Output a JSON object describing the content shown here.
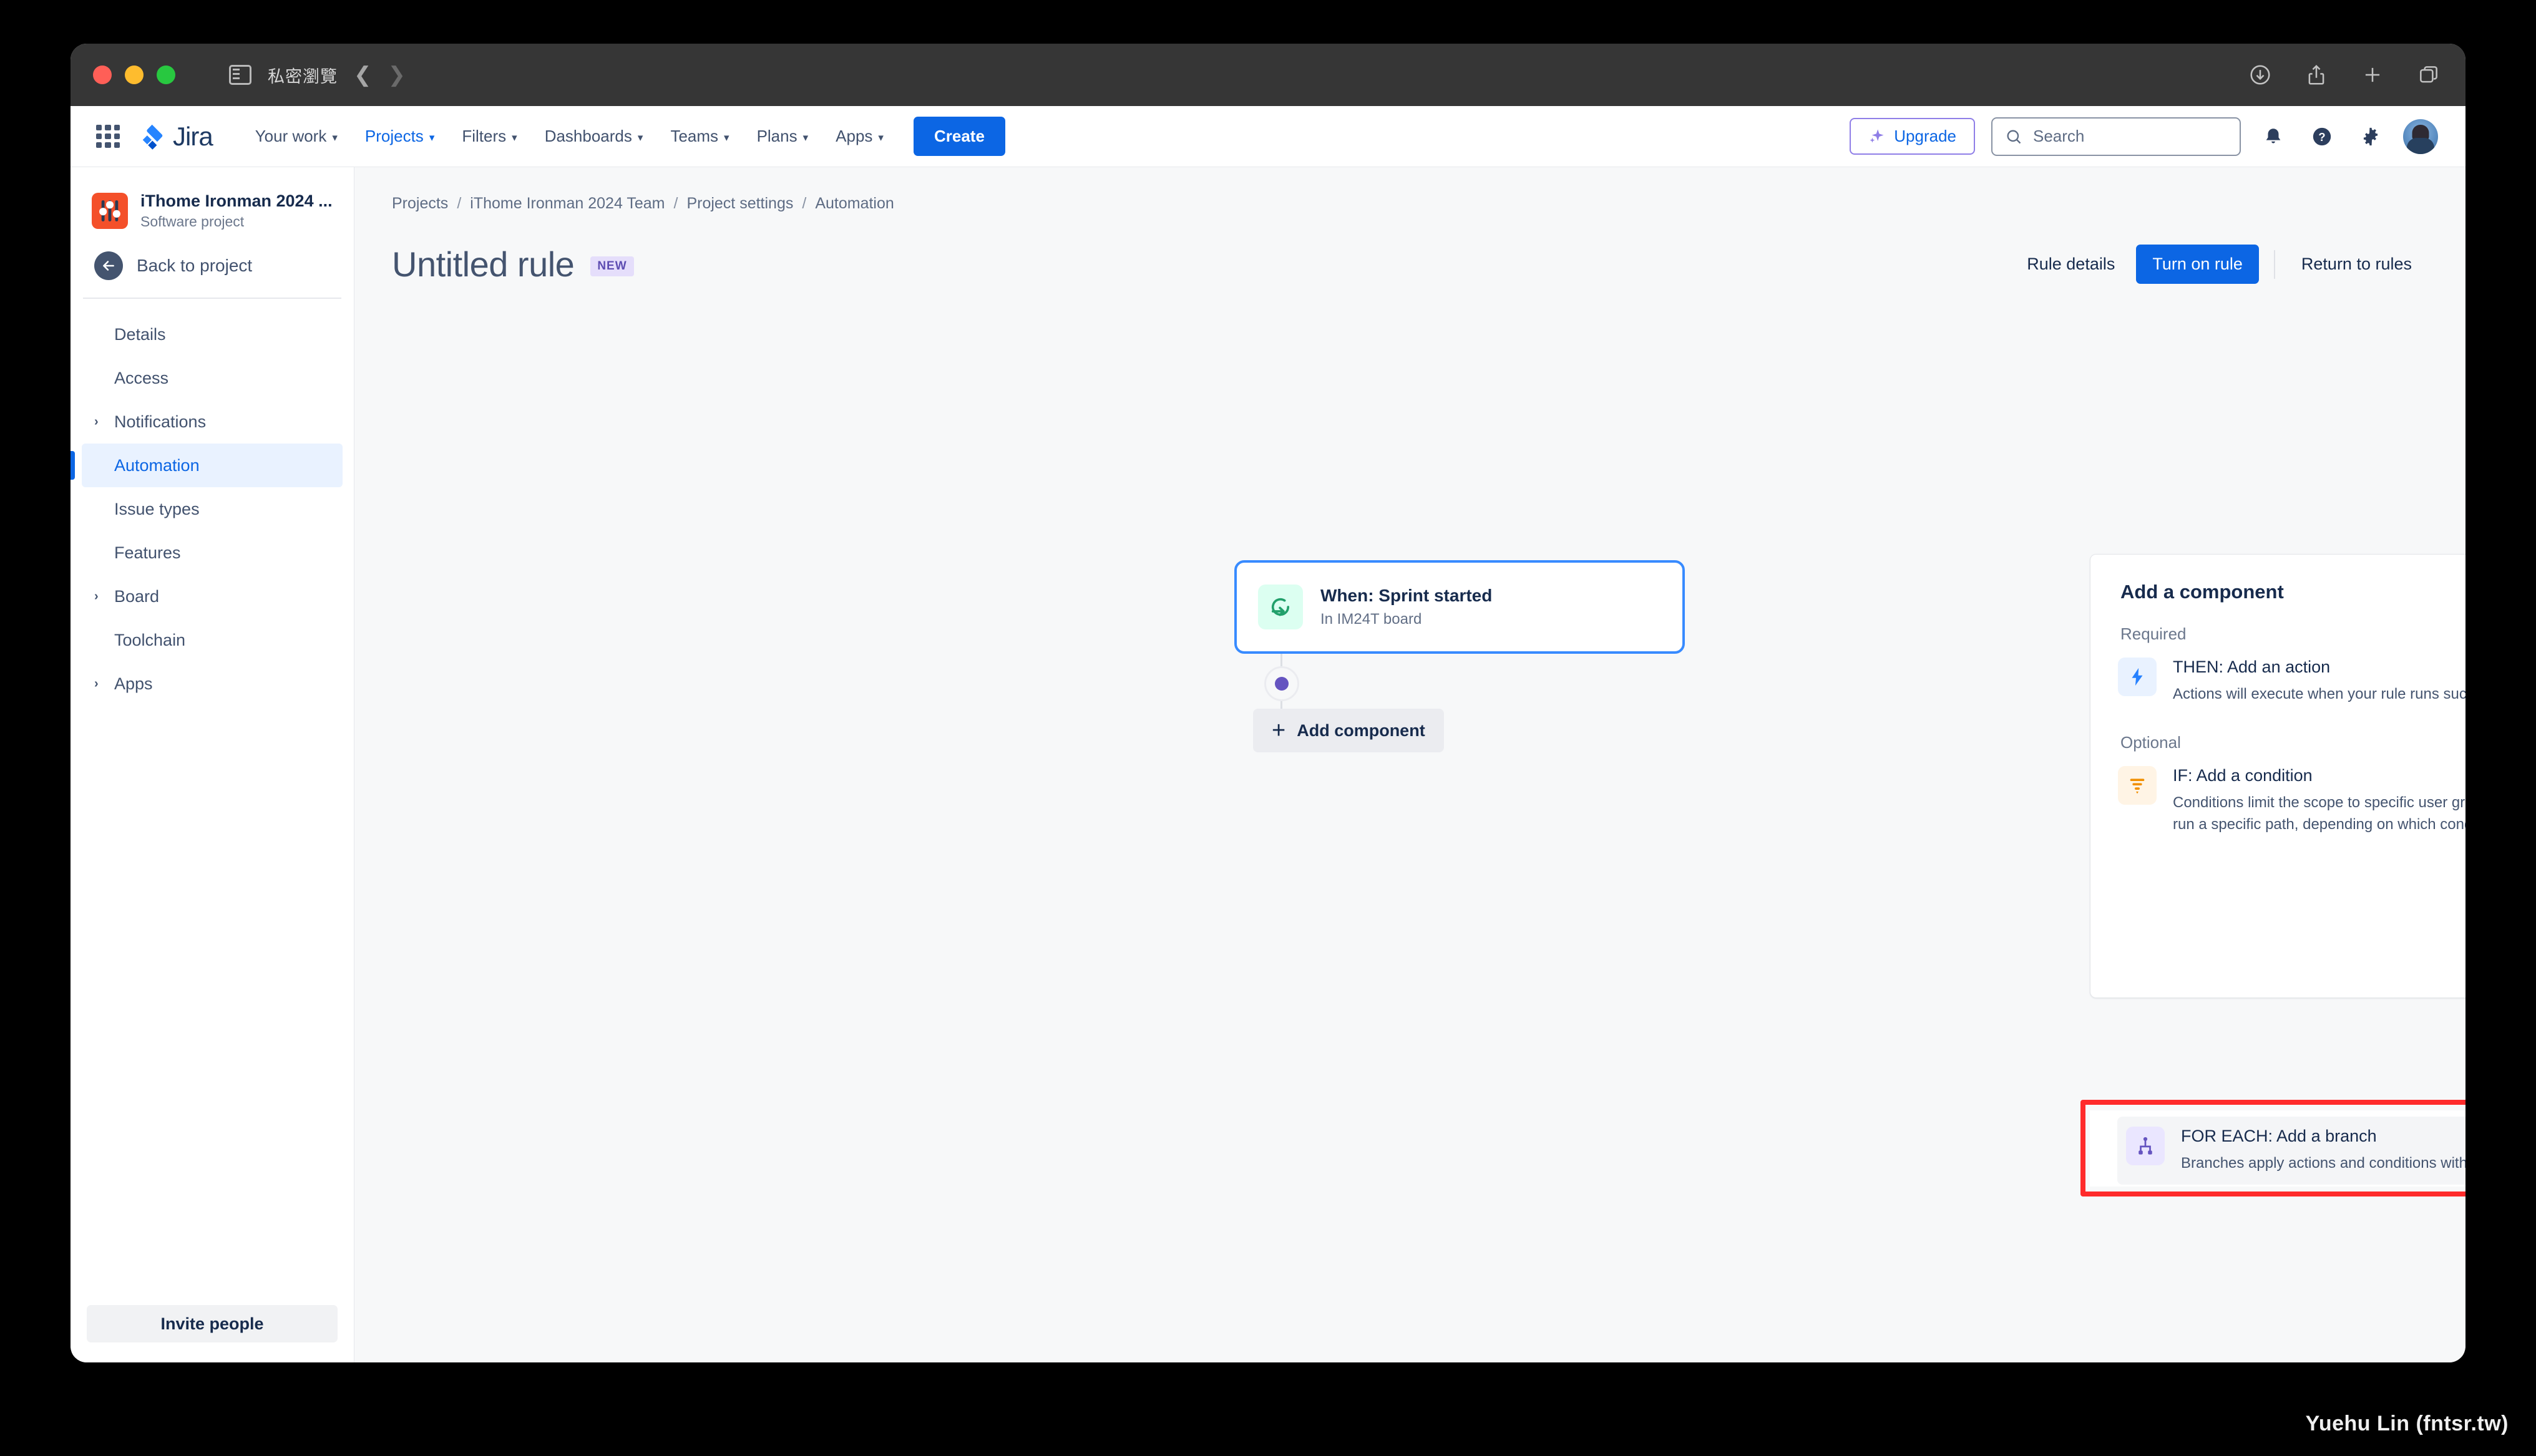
{
  "browser": {
    "private_label": "私密瀏覽",
    "back_icon": "chevron-left-icon",
    "forward_icon": "chevron-right-icon",
    "sidebar_icon": "sidebar-toggle-icon",
    "toolbar_icons": [
      "downloads-icon",
      "share-icon",
      "new-tab-icon",
      "tab-overview-icon"
    ]
  },
  "topnav": {
    "app_switcher_icon": "app-switcher-icon",
    "logo_text": "Jira",
    "items": [
      {
        "label": "Your work",
        "has_caret": true,
        "active": false
      },
      {
        "label": "Projects",
        "has_caret": true,
        "active": true
      },
      {
        "label": "Filters",
        "has_caret": true,
        "active": false
      },
      {
        "label": "Dashboards",
        "has_caret": true,
        "active": false
      },
      {
        "label": "Teams",
        "has_caret": true,
        "active": false
      },
      {
        "label": "Plans",
        "has_caret": true,
        "active": false
      },
      {
        "label": "Apps",
        "has_caret": true,
        "active": false
      }
    ],
    "create_label": "Create",
    "upgrade_label": "Upgrade",
    "search_placeholder": "Search",
    "notifications_icon": "bell-icon",
    "help_icon": "help-icon",
    "settings_icon": "gear-icon",
    "avatar_icon": "avatar"
  },
  "sidebar": {
    "project_name": "iThome Ironman 2024 ...",
    "project_type": "Software project",
    "back_label": "Back to project",
    "items": [
      {
        "label": "Details",
        "expandable": false,
        "selected": false
      },
      {
        "label": "Access",
        "expandable": false,
        "selected": false
      },
      {
        "label": "Notifications",
        "expandable": true,
        "selected": false
      },
      {
        "label": "Automation",
        "expandable": false,
        "selected": true
      },
      {
        "label": "Issue types",
        "expandable": false,
        "selected": false
      },
      {
        "label": "Features",
        "expandable": false,
        "selected": false
      },
      {
        "label": "Board",
        "expandable": true,
        "selected": false
      },
      {
        "label": "Toolchain",
        "expandable": false,
        "selected": false
      },
      {
        "label": "Apps",
        "expandable": true,
        "selected": false
      }
    ],
    "invite_label": "Invite people"
  },
  "breadcrumb": [
    {
      "label": "Projects"
    },
    {
      "label": "iThome Ironman 2024 Team"
    },
    {
      "label": "Project settings"
    },
    {
      "label": "Automation"
    }
  ],
  "page": {
    "title": "Untitled rule",
    "badge": "NEW",
    "rule_details_label": "Rule details",
    "turn_on_label": "Turn on rule",
    "return_label": "Return to rules"
  },
  "canvas": {
    "trigger": {
      "icon": "sprint-started-icon",
      "title": "When: Sprint started",
      "subtitle": "In IM24T board"
    },
    "add_component_label": "Add component",
    "plus_icon": "plus-icon",
    "connector_dot_color": "#6554c0"
  },
  "panel": {
    "title": "Add a component",
    "sections": [
      {
        "label": "Required",
        "items": [
          {
            "icon": "lightning-bolt-icon",
            "title": "THEN: Add an action",
            "desc": "Actions will execute when your rule runs successfully."
          }
        ]
      },
      {
        "label": "Optional",
        "items": [
          {
            "icon": "funnel-filter-icon",
            "title": "IF: Add a condition",
            "desc": "Conditions limit the scope to specific user groups or keywords. You can make your rule run a specific path, depending on which condition is met."
          }
        ]
      }
    ],
    "highlighted_item": {
      "icon": "branch-icon",
      "title": "FOR EACH: Add a branch",
      "desc": "Branches apply actions and conditions within them to \"each page\" or \"each task\" etc.",
      "highlight_color": "#ff2b2b"
    }
  },
  "watermark": "Yuehu Lin (fntsr.tw)"
}
